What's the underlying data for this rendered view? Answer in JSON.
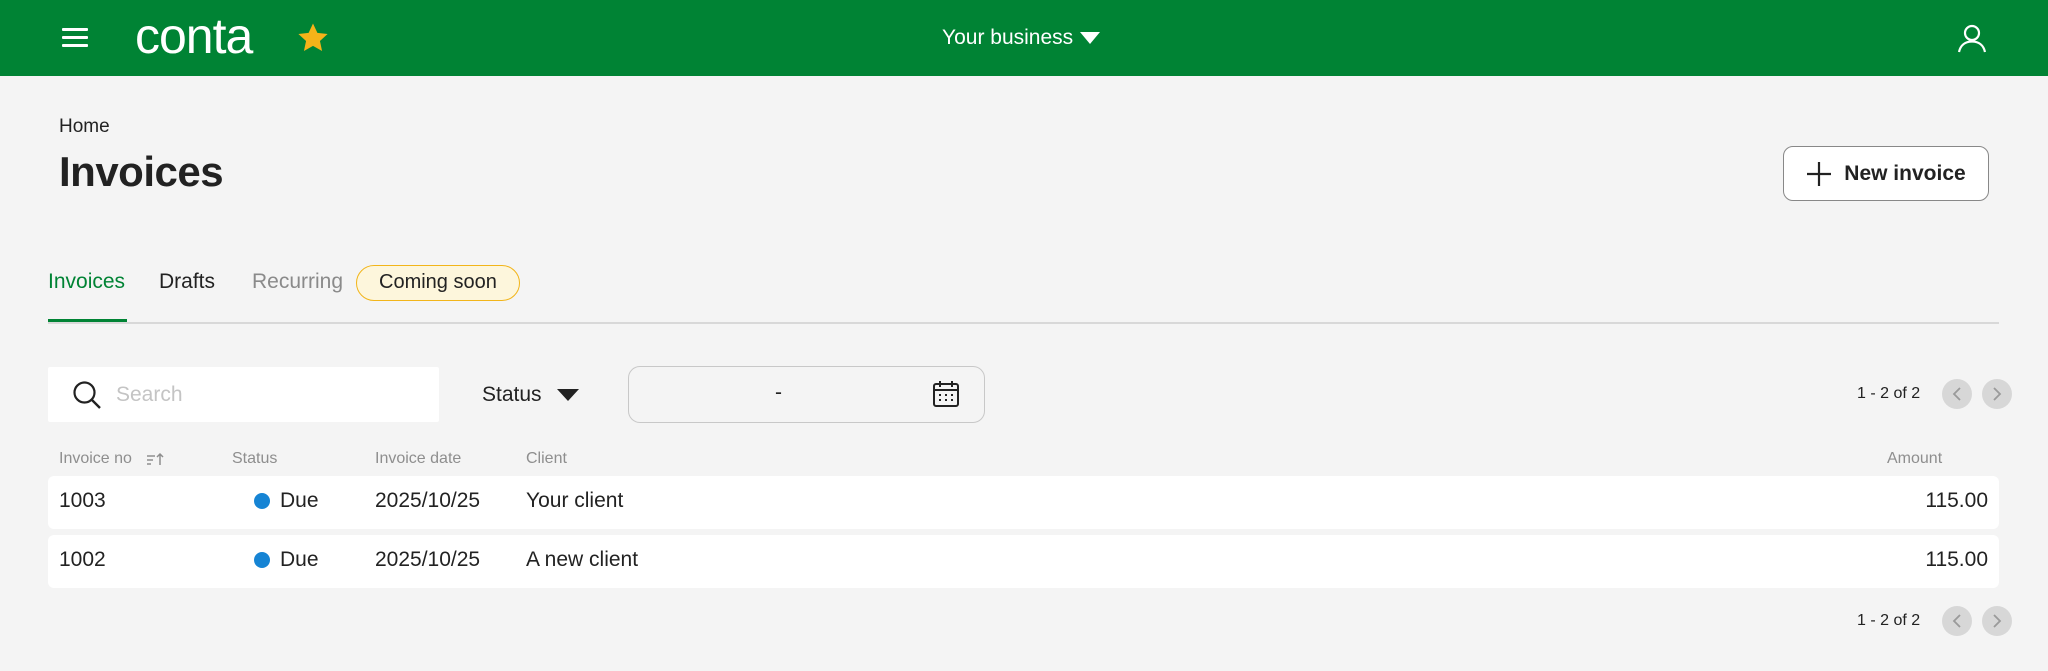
{
  "header": {
    "logo_text": "conta",
    "business_selector": "Your business",
    "colors": {
      "brand": "#008334",
      "star": "#f5b319"
    }
  },
  "breadcrumb": "Home",
  "page_title": "Invoices",
  "new_invoice_label": "New invoice",
  "tabs": {
    "invoices": "Invoices",
    "drafts": "Drafts",
    "recurring": "Recurring",
    "coming_soon_badge": "Coming soon"
  },
  "filters": {
    "search_placeholder": "Search",
    "search_value": "",
    "status_label": "Status",
    "date_range_separator": "-"
  },
  "pagination": {
    "range_text": "1 - 2 of 2"
  },
  "table": {
    "columns": [
      "Invoice no",
      "Status",
      "Invoice date",
      "Client",
      "Amount"
    ],
    "rows": [
      {
        "invoice_no": "1003",
        "status": "Due",
        "date": "2025/10/25",
        "client": "Your client",
        "amount": "115.00"
      },
      {
        "invoice_no": "1002",
        "status": "Due",
        "date": "2025/10/25",
        "client": "A new client",
        "amount": "115.00"
      }
    ],
    "status_color_due": "#1684d4"
  }
}
